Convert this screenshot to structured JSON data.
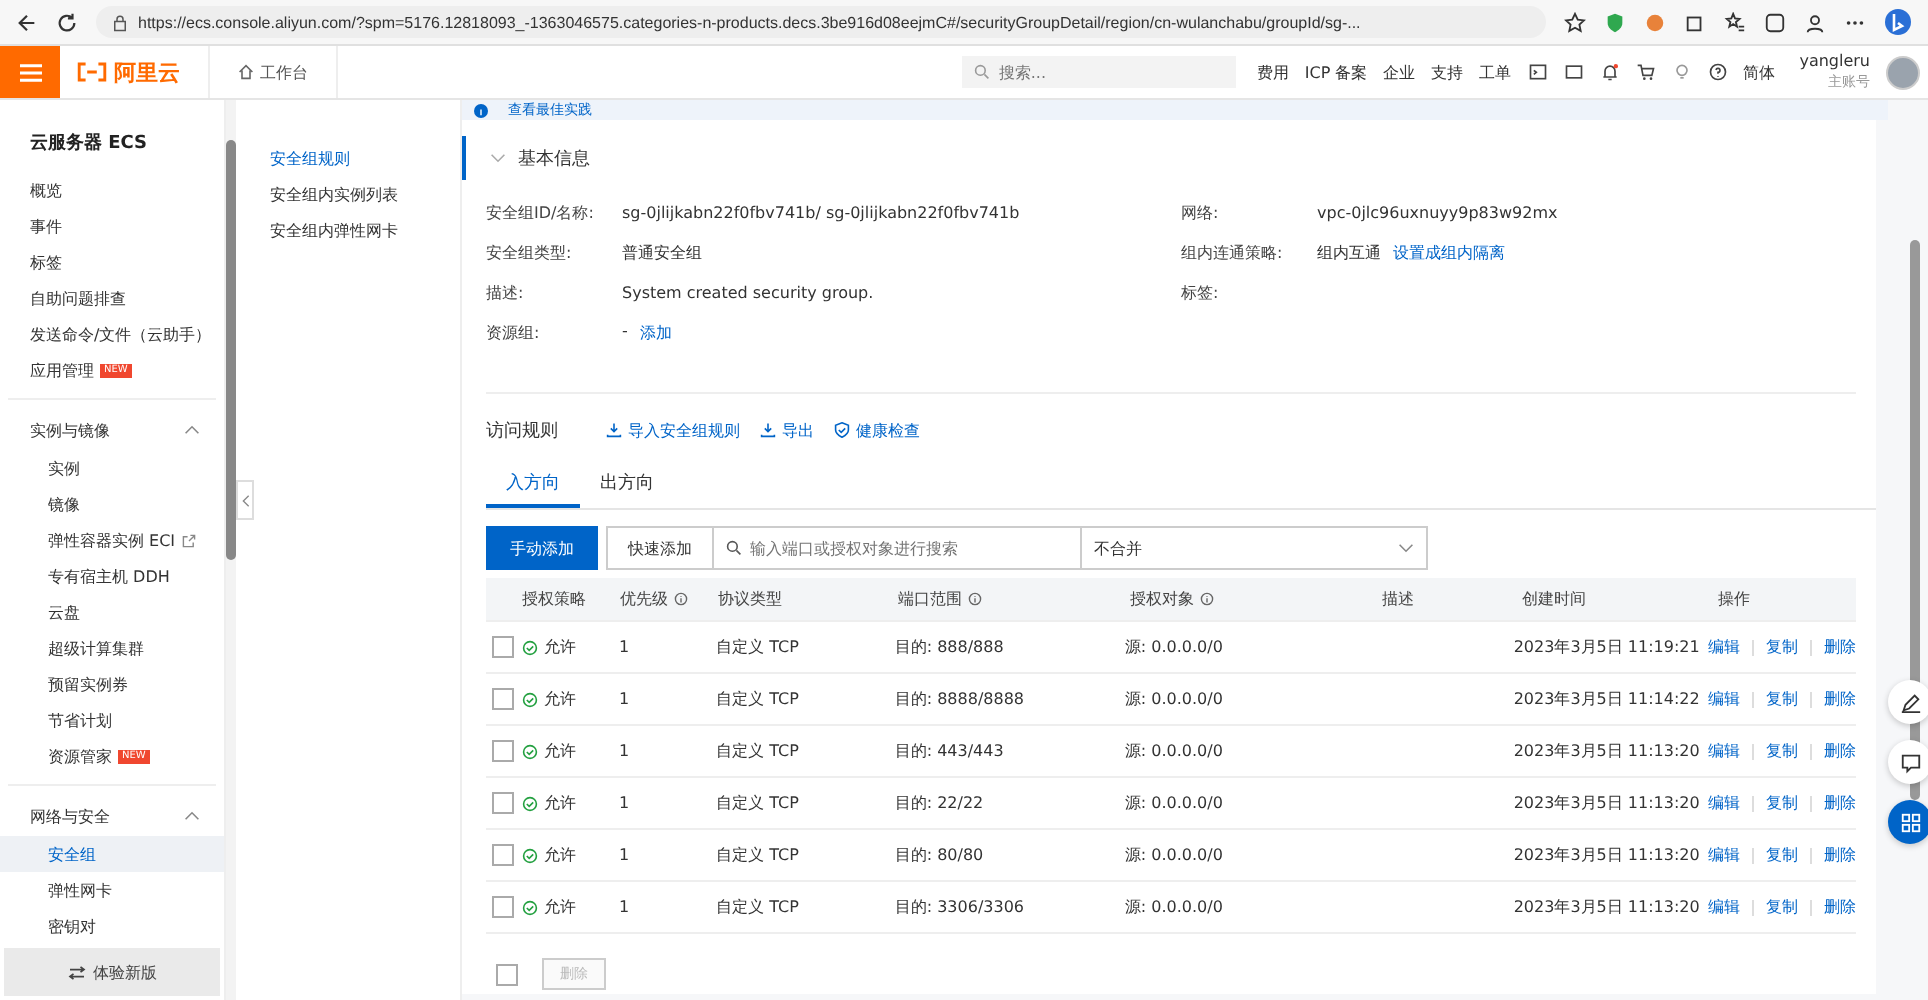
{
  "browser": {
    "url": "https://ecs.console.aliyun.com/?spm=5176.12818093_-1363046575.categories-n-products.decs.3be916d08eejmC#/securityGroupDetail/region/cn-wulanchabu/groupId/sg-..."
  },
  "header": {
    "logo": "阿里云",
    "workbench": "工作台",
    "search_placeholder": "搜索...",
    "nav": [
      "费用",
      "ICP 备案",
      "企业",
      "支持",
      "工单"
    ],
    "language": "简体",
    "user": "yangleru",
    "account_type": "主账号"
  },
  "notice": {
    "link": "查看最佳实践"
  },
  "sidebar": {
    "title": "云服务器 ECS",
    "items": [
      {
        "label": "概览",
        "selected": false
      },
      {
        "label": "事件",
        "selected": false
      },
      {
        "label": "标签",
        "selected": false
      },
      {
        "label": "自助问题排查",
        "selected": false
      },
      {
        "label": "发送命令/文件（云助手）",
        "selected": false
      },
      {
        "label": "应用管理",
        "selected": false,
        "badge": "NEW"
      }
    ],
    "groups": [
      {
        "title": "实例与镜像",
        "expanded": true,
        "items": [
          {
            "label": "实例",
            "selected": false
          },
          {
            "label": "镜像",
            "selected": false
          },
          {
            "label": "弹性容器实例 ECI",
            "selected": false,
            "external": true
          },
          {
            "label": "专有宿主机 DDH",
            "selected": false
          },
          {
            "label": "云盘",
            "selected": false
          },
          {
            "label": "超级计算集群",
            "selected": false
          },
          {
            "label": "预留实例券",
            "selected": false
          },
          {
            "label": "节省计划",
            "selected": false
          },
          {
            "label": "资源管家",
            "selected": false,
            "badge": "NEW"
          }
        ]
      },
      {
        "title": "网络与安全",
        "expanded": true,
        "items": [
          {
            "label": "安全组",
            "selected": true
          },
          {
            "label": "弹性网卡",
            "selected": false
          },
          {
            "label": "密钥对",
            "selected": false
          }
        ]
      }
    ],
    "footer": "体验新版"
  },
  "subnav": [
    {
      "label": "安全组规则",
      "selected": true
    },
    {
      "label": "安全组内实例列表",
      "selected": false
    },
    {
      "label": "安全组内弹性网卡",
      "selected": false
    }
  ],
  "basic_info": {
    "title": "基本信息",
    "left": [
      {
        "label": "安全组ID/名称:",
        "value": "sg-0jlijkabn22f0fbv741b/ sg-0jlijkabn22f0fbv741b"
      },
      {
        "label": "安全组类型:",
        "value": "普通安全组"
      },
      {
        "label": "描述:",
        "value": "System created security group."
      },
      {
        "label": "资源组:",
        "value": "- ",
        "link": "添加"
      }
    ],
    "right": [
      {
        "label": "网络:",
        "value": "vpc-0jlc96uxnuyy9p83w92mx"
      },
      {
        "label": "组内连通策略:",
        "value": "组内互通",
        "link": "设置成组内隔离"
      },
      {
        "label": "标签:"
      }
    ]
  },
  "rules": {
    "title": "访问规则",
    "actions": [
      {
        "kind": "import",
        "label": "导入安全组规则"
      },
      {
        "kind": "export",
        "label": "导出"
      },
      {
        "kind": "check",
        "label": "健康检查"
      }
    ],
    "tabs": [
      {
        "label": "入方向",
        "selected": true
      },
      {
        "label": "出方向",
        "selected": false
      }
    ],
    "add_button": "手动添加",
    "quick_add_button": "快速添加",
    "search_placeholder": "输入端口或授权对象进行搜索",
    "merge_select": "不合并",
    "columns": [
      {
        "label": "授权策略",
        "info": false
      },
      {
        "label": "优先级",
        "info": true
      },
      {
        "label": "协议类型",
        "info": false
      },
      {
        "label": "端口范围",
        "info": true
      },
      {
        "label": "授权对象",
        "info": true
      },
      {
        "label": "描述",
        "info": false
      },
      {
        "label": "创建时间",
        "info": false
      },
      {
        "label": "操作",
        "info": false
      }
    ],
    "rows": [
      {
        "checked": false,
        "policy": "允许",
        "priority": "1",
        "protocol": "自定义 TCP",
        "port": "目的: 888/888",
        "object": "源: 0.0.0.0/0",
        "created": "2023年3月5日 11:19:21",
        "ops": [
          "编辑",
          "复制",
          "删除"
        ]
      },
      {
        "checked": false,
        "policy": "允许",
        "priority": "1",
        "protocol": "自定义 TCP",
        "port": "目的: 8888/8888",
        "object": "源: 0.0.0.0/0",
        "created": "2023年3月5日 11:14:22",
        "ops": [
          "编辑",
          "复制",
          "删除"
        ]
      },
      {
        "checked": false,
        "policy": "允许",
        "priority": "1",
        "protocol": "自定义 TCP",
        "port": "目的: 443/443",
        "object": "源: 0.0.0.0/0",
        "created": "2023年3月5日 11:13:20",
        "ops": [
          "编辑",
          "复制",
          "删除"
        ]
      },
      {
        "checked": false,
        "policy": "允许",
        "priority": "1",
        "protocol": "自定义 TCP",
        "port": "目的: 22/22",
        "object": "源: 0.0.0.0/0",
        "created": "2023年3月5日 11:13:20",
        "ops": [
          "编辑",
          "复制",
          "删除"
        ]
      },
      {
        "checked": false,
        "policy": "允许",
        "priority": "1",
        "protocol": "自定义 TCP",
        "port": "目的: 80/80",
        "object": "源: 0.0.0.0/0",
        "created": "2023年3月5日 11:13:20",
        "ops": [
          "编辑",
          "复制",
          "删除"
        ]
      },
      {
        "checked": false,
        "policy": "允许",
        "priority": "1",
        "protocol": "自定义 TCP",
        "port": "目的: 3306/3306",
        "object": "源: 0.0.0.0/0",
        "created": "2023年3月5日 11:13:20",
        "ops": [
          "编辑",
          "复制",
          "删除"
        ]
      }
    ],
    "footer": {
      "select_all_checked": false,
      "delete_button": "删除",
      "delete_disabled": true
    }
  }
}
